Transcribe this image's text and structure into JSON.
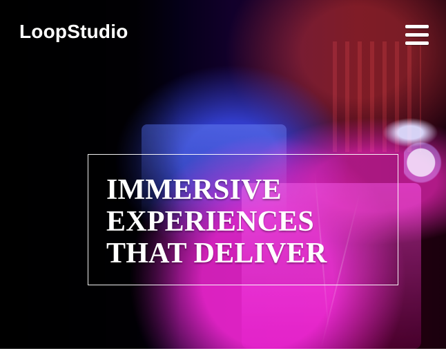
{
  "brand": {
    "name": "LoopStudio"
  },
  "header": {
    "menu_icon": "hamburger-menu-icon"
  },
  "hero": {
    "headline_lines": [
      "IMMERSIVE",
      "EXPERIENCES",
      "THAT DELIVER"
    ]
  },
  "colors": {
    "text": "#ffffff",
    "box_border": "#ffffff"
  }
}
